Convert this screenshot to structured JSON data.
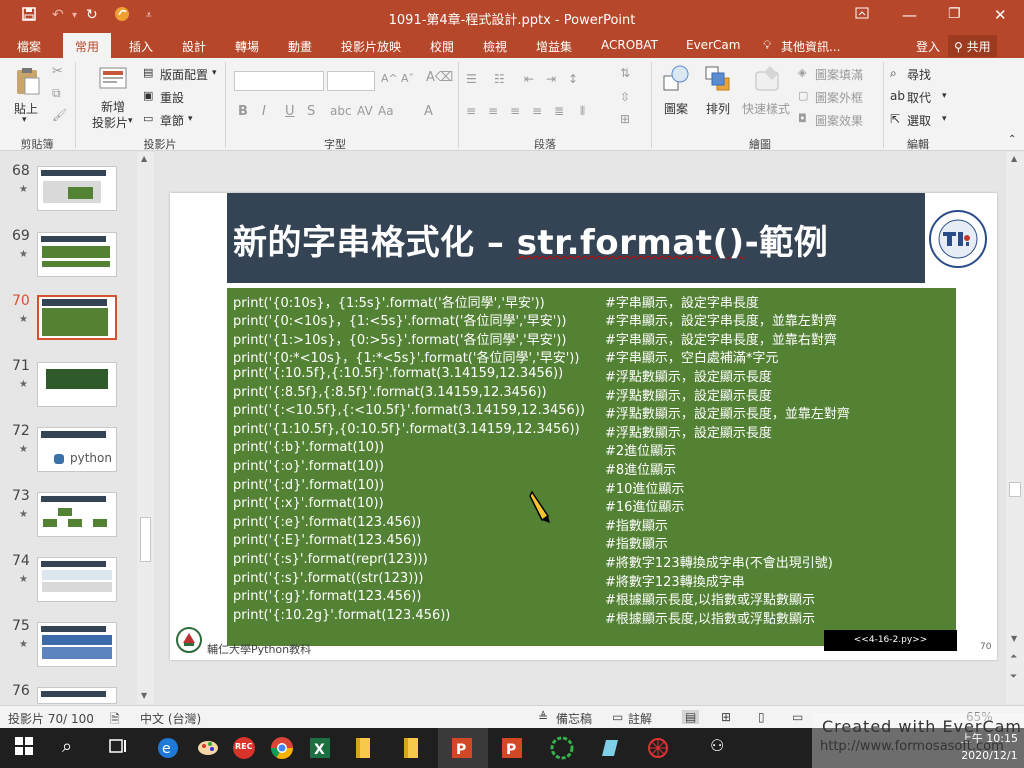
{
  "window": {
    "title": "1091-第4章-程式設計.pptx - PowerPoint"
  },
  "tabs": [
    "檔案",
    "常用",
    "插入",
    "設計",
    "轉場",
    "動畫",
    "投影片放映",
    "校閱",
    "檢視",
    "增益集",
    "ACROBAT",
    "EverCam",
    "其他資訊..."
  ],
  "account": {
    "signin": "登入",
    "share": "共用"
  },
  "ribbon": {
    "clipboard": {
      "paste": "貼上",
      "label": "剪貼簿"
    },
    "slides": {
      "new_slide_1": "新增",
      "new_slide_2": "投影片",
      "layout": "版面配置",
      "reset": "重設",
      "section": "章節",
      "label": "投影片"
    },
    "font": {
      "label": "字型",
      "bold": "B",
      "italic": "I",
      "underline": "U",
      "strike": "S",
      "aa": "Aa"
    },
    "paragraph": {
      "label": "段落"
    },
    "drawing": {
      "shapes": "圖案",
      "arrange": "排列",
      "quick_styles": "快速樣式",
      "fill": "圖案填滿",
      "outline": "圖案外框",
      "effects": "圖案效果",
      "label": "繪圖"
    },
    "editing": {
      "find": "尋找",
      "replace": "取代",
      "select": "選取",
      "label": "編輯"
    }
  },
  "thumbnails": [
    {
      "num": "68",
      "star": "★"
    },
    {
      "num": "69",
      "star": "★"
    },
    {
      "num": "70",
      "star": "★"
    },
    {
      "num": "71",
      "star": "★"
    },
    {
      "num": "72",
      "star": "★",
      "caption": "python"
    },
    {
      "num": "73",
      "star": "★"
    },
    {
      "num": "74",
      "star": "★"
    },
    {
      "num": "75",
      "star": "★"
    },
    {
      "num": "76",
      "star": "★"
    }
  ],
  "slide": {
    "title_zh": "新的字串格式化 – ",
    "title_en": "str.format()",
    "title_tail": "-範例",
    "lines": [
      {
        "code": "print('{0:10s}，{1:5s}'.format('各位同學','早安'))",
        "comment": "#字串顯示，設定字串長度"
      },
      {
        "code": "print('{0:<10s}，{1:<5s}'.format('各位同學','早安'))",
        "comment": "#字串顯示，設定字串長度，並靠左對齊"
      },
      {
        "code": "print('{1:>10s}，{0:>5s}'.format('各位同學','早安'))",
        "comment": "#字串顯示，設定字串長度，並靠右對齊"
      },
      {
        "code": "print('{0:*<10s}，{1:*<5s}'.format('各位同學','早安'))",
        "comment": "#字串顯示，空白處補滿*字元"
      },
      {
        "code": "print('{:10.5f},{:10.5f}'.format(3.14159,12.3456))",
        "comment": "#浮點數顯示，設定顯示長度"
      },
      {
        "code": "print('{:8.5f},{:8.5f}'.format(3.14159,12.3456))",
        "comment": "#浮點數顯示，設定顯示長度"
      },
      {
        "code": "print('{:<10.5f},{:<10.5f}'.format(3.14159,12.3456))",
        "comment": "#浮點數顯示，設定顯示長度，並靠左對齊"
      },
      {
        "code": "print('{1:10.5f},{0:10.5f}'.format(3.14159,12.3456))",
        "comment": "#浮點數顯示，設定顯示長度"
      },
      {
        "code": "print('{:b}'.format(10))",
        "comment": "#2進位顯示"
      },
      {
        "code": "print('{:o}'.format(10))",
        "comment": "#8進位顯示"
      },
      {
        "code": "print('{:d}'.format(10))",
        "comment": "#10進位顯示"
      },
      {
        "code": "print('{:x}'.format(10))",
        "comment": "#16進位顯示"
      },
      {
        "code": "print('{:e}'.format(123.456))",
        "comment": "#指數顯示"
      },
      {
        "code": "print('{:E}'.format(123.456))",
        "comment": "#指數顯示"
      },
      {
        "code": "print('{:s}'.format(repr(123)))",
        "comment": "#將數字123轉換成字串(不會出現引號)"
      },
      {
        "code": "print('{:s}'.format((str(123)))",
        "comment": "#將數字123轉換成字串"
      },
      {
        "code": "print('{:g}'.format(123.456))",
        "comment": "#根據顯示長度,以指數或浮點數顯示"
      },
      {
        "code": "print('{:10.2g}'.format(123.456))",
        "comment": "#根據顯示長度,以指數或浮點數顯示"
      }
    ],
    "file_label": "<<4-16-2.py>>",
    "footer": "輔仁大學Python教科",
    "page_number": "70"
  },
  "status": {
    "slide_count": "投影片 70/ 100",
    "language": "中文 (台灣)",
    "notes": "備忘稿",
    "comments": "註解",
    "zoom": "65%"
  },
  "watermark": {
    "line1": "Created with EverCam",
    "line2": "http://www.formosasoft.com"
  },
  "clock": {
    "time": "上午 10:15",
    "date": "2020/12/1"
  },
  "taskbar": {
    "rec_label": "REC"
  },
  "colors": {
    "accent": "#b7472a",
    "slide_title_bg": "#354454",
    "code_bg": "#548235"
  }
}
